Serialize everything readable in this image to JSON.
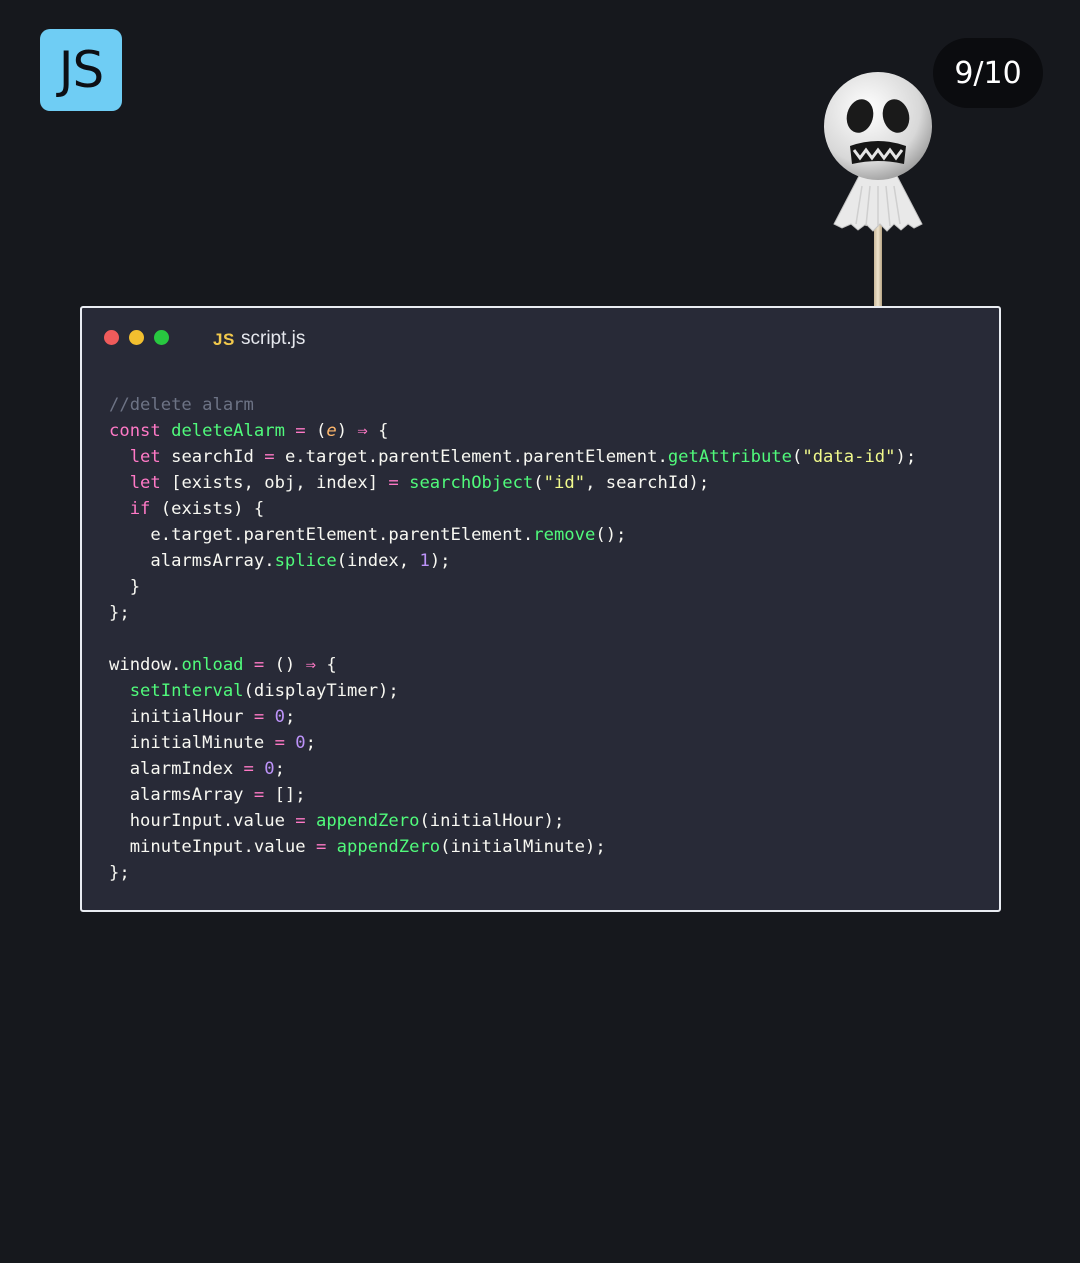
{
  "logo": {
    "text": "JS"
  },
  "page_indicator": "9/10",
  "editor": {
    "window_controls": [
      "close",
      "minimize",
      "maximize"
    ],
    "file_icon": "JS",
    "file_name": "script.js"
  },
  "code_lines": [
    [
      {
        "t": "//delete alarm",
        "c": "c"
      }
    ],
    [
      {
        "t": "const ",
        "c": "k"
      },
      {
        "t": "deleteAlarm",
        "c": "f"
      },
      {
        "t": " = ",
        "c": "o"
      },
      {
        "t": "(",
        "c": "p"
      },
      {
        "t": "e",
        "c": "i"
      },
      {
        "t": ") ",
        "c": "p"
      },
      {
        "t": "⇒",
        "c": "o"
      },
      {
        "t": " {",
        "c": "p"
      }
    ],
    [
      {
        "t": "  let ",
        "c": "k"
      },
      {
        "t": "searchId ",
        "c": "v"
      },
      {
        "t": "= ",
        "c": "o"
      },
      {
        "t": "e.target.parentElement.parentElement.",
        "c": "v"
      },
      {
        "t": "getAttribute",
        "c": "f"
      },
      {
        "t": "(",
        "c": "p"
      },
      {
        "t": "\"data-id\"",
        "c": "s"
      },
      {
        "t": ");",
        "c": "p"
      }
    ],
    [
      {
        "t": "  let ",
        "c": "k"
      },
      {
        "t": "[exists, obj, index] ",
        "c": "v"
      },
      {
        "t": "= ",
        "c": "o"
      },
      {
        "t": "searchObject",
        "c": "f"
      },
      {
        "t": "(",
        "c": "p"
      },
      {
        "t": "\"id\"",
        "c": "s"
      },
      {
        "t": ", searchId);",
        "c": "p"
      }
    ],
    [
      {
        "t": "  if ",
        "c": "k"
      },
      {
        "t": "(exists) {",
        "c": "p"
      }
    ],
    [
      {
        "t": "    e.target.parentElement.parentElement.",
        "c": "v"
      },
      {
        "t": "remove",
        "c": "f"
      },
      {
        "t": "();",
        "c": "p"
      }
    ],
    [
      {
        "t": "    alarmsArray.",
        "c": "v"
      },
      {
        "t": "splice",
        "c": "f"
      },
      {
        "t": "(index, ",
        "c": "p"
      },
      {
        "t": "1",
        "c": "n"
      },
      {
        "t": ");",
        "c": "p"
      }
    ],
    [
      {
        "t": "  }",
        "c": "p"
      }
    ],
    [
      {
        "t": "};",
        "c": "p"
      }
    ],
    [],
    [
      {
        "t": "window.",
        "c": "v"
      },
      {
        "t": "onload",
        "c": "f"
      },
      {
        "t": " = ",
        "c": "o"
      },
      {
        "t": "() ",
        "c": "p"
      },
      {
        "t": "⇒",
        "c": "o"
      },
      {
        "t": " {",
        "c": "p"
      }
    ],
    [
      {
        "t": "  ",
        "c": "p"
      },
      {
        "t": "setInterval",
        "c": "f"
      },
      {
        "t": "(displayTimer);",
        "c": "p"
      }
    ],
    [
      {
        "t": "  initialHour ",
        "c": "v"
      },
      {
        "t": "= ",
        "c": "o"
      },
      {
        "t": "0",
        "c": "n"
      },
      {
        "t": ";",
        "c": "p"
      }
    ],
    [
      {
        "t": "  initialMinute ",
        "c": "v"
      },
      {
        "t": "= ",
        "c": "o"
      },
      {
        "t": "0",
        "c": "n"
      },
      {
        "t": ";",
        "c": "p"
      }
    ],
    [
      {
        "t": "  alarmIndex ",
        "c": "v"
      },
      {
        "t": "= ",
        "c": "o"
      },
      {
        "t": "0",
        "c": "n"
      },
      {
        "t": ";",
        "c": "p"
      }
    ],
    [
      {
        "t": "  alarmsArray ",
        "c": "v"
      },
      {
        "t": "= ",
        "c": "o"
      },
      {
        "t": "[];",
        "c": "p"
      }
    ],
    [
      {
        "t": "  hourInput.value ",
        "c": "v"
      },
      {
        "t": "= ",
        "c": "o"
      },
      {
        "t": "appendZero",
        "c": "f"
      },
      {
        "t": "(initialHour);",
        "c": "p"
      }
    ],
    [
      {
        "t": "  minuteInput.value ",
        "c": "v"
      },
      {
        "t": "= ",
        "c": "o"
      },
      {
        "t": "appendZero",
        "c": "f"
      },
      {
        "t": "(initialMinute);",
        "c": "p"
      }
    ],
    [
      {
        "t": "};",
        "c": "p"
      }
    ]
  ],
  "decor": {
    "ghost": "ghost-lollipop-icon"
  }
}
